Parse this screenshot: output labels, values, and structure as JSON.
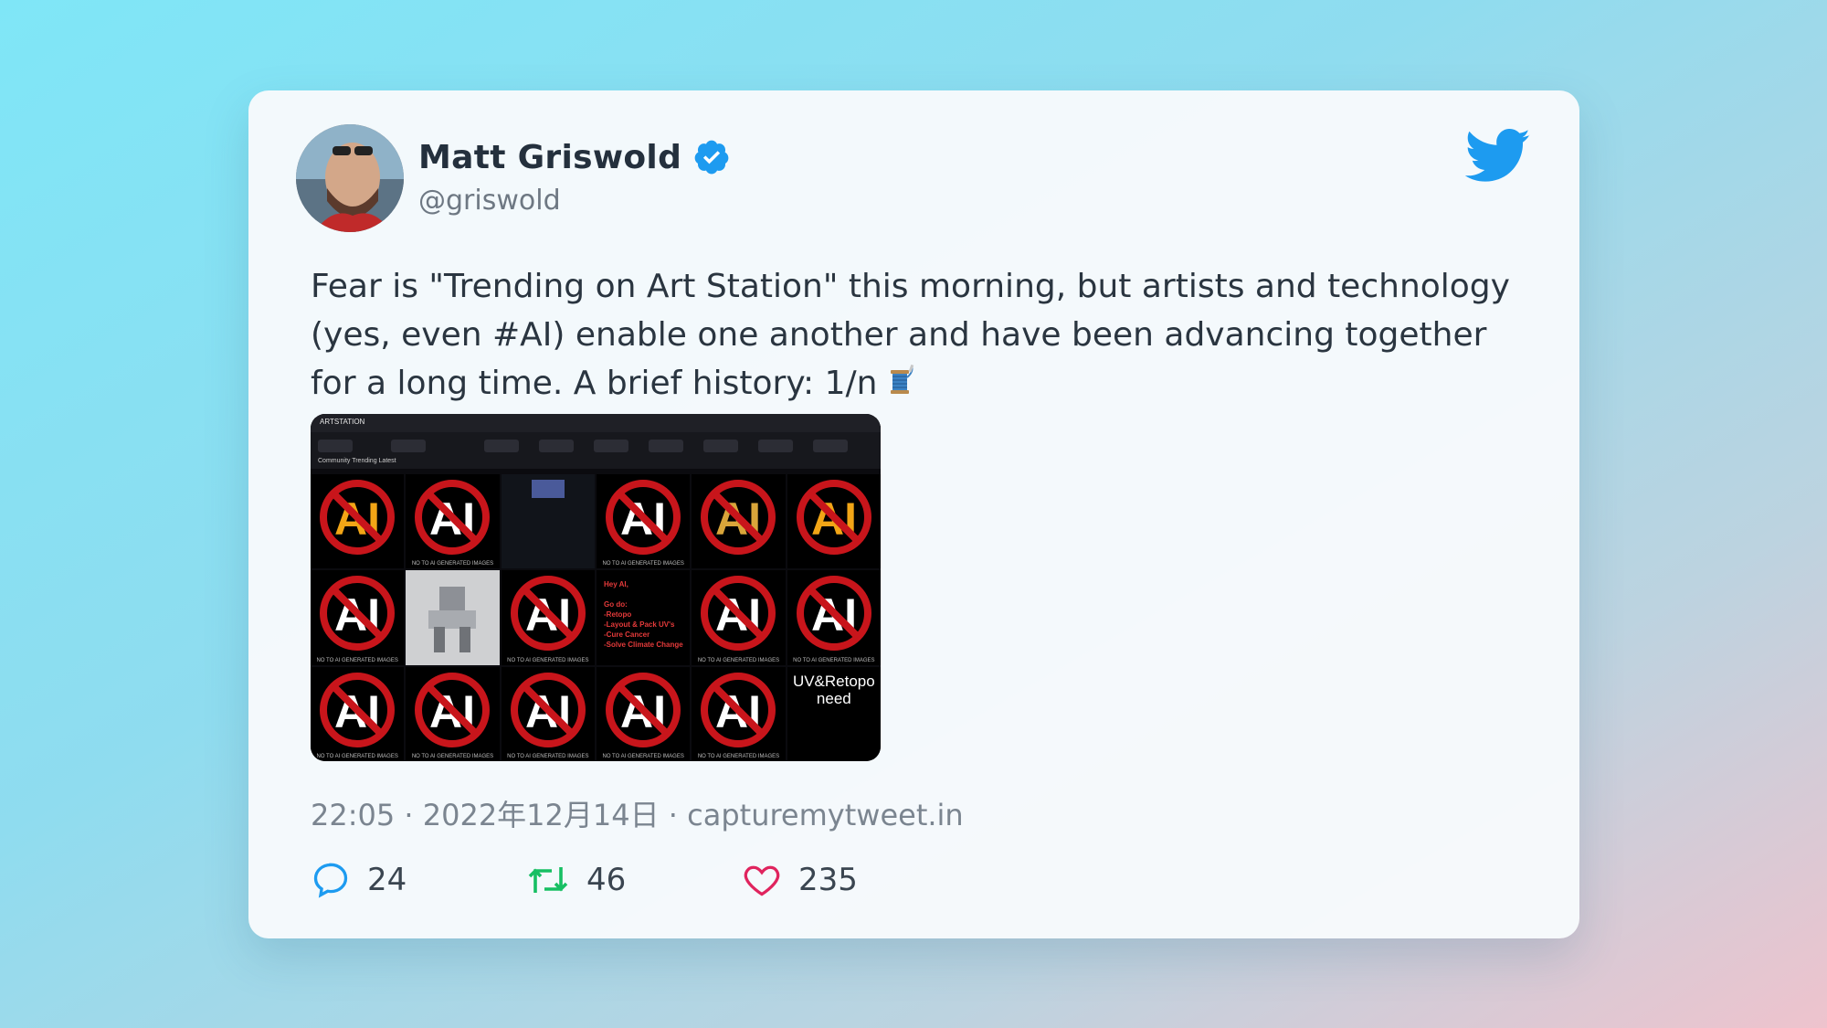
{
  "user": {
    "name": "Matt Griswold",
    "handle": "@griswold",
    "verified": true
  },
  "tweet": {
    "text": "Fear is \"Trending on Art Station\" this morning, but artists and technology (yes, even #AI) enable one another and have been advancing together for a long time. A brief history: 1/n",
    "emoji": "spool-of-thread-icon"
  },
  "media": {
    "brand": "ARTSTATION",
    "tabs": "Community   Trending   Latest",
    "caption": "NO TO AI GENERATED IMAGES",
    "red_text": "Hey AI,\n\nGo do:\n-Retopo\n-Layout & Pack UV's\n-Cure Cancer\n-Solve Climate Change",
    "uv_text": "UV&Retopo\nneed"
  },
  "meta": {
    "line": "22:05 · 2022年12月14日 · capturemytweet.in"
  },
  "stats": {
    "replies": "24",
    "retweets": "46",
    "likes": "235"
  },
  "colors": {
    "twitter_blue": "#1d9bf0",
    "retweet_green": "#17bf63",
    "like_pink": "#e0245e"
  }
}
